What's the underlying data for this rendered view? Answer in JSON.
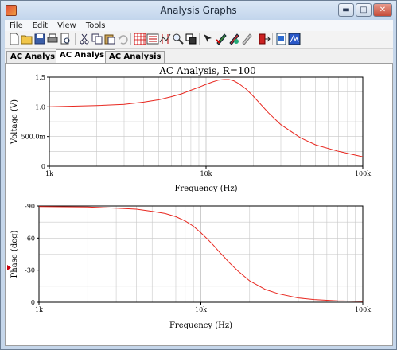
{
  "window": {
    "title": "Analysis Graphs"
  },
  "menu": [
    "File",
    "Edit",
    "View",
    "Tools"
  ],
  "toolbar": {
    "icons": [
      "new-icon",
      "open-icon",
      "save-icon",
      "print-icon",
      "print-preview-icon",
      "cut-icon",
      "copy-icon",
      "paste-icon",
      "undo-icon",
      "grid-icon",
      "legend-icon",
      "cursors-icon",
      "zoom-icon",
      "overlay-icon",
      "select-trace-icon",
      "pen-color-icon",
      "pen-style-icon",
      "properties-icon",
      "export-icon",
      "page-properties-icon",
      "graph-properties-icon"
    ]
  },
  "tabs": [
    "AC Analysis",
    "AC Analysis",
    "AC Analysis"
  ],
  "active_tab": 1,
  "colors": {
    "trace": "#e8271f",
    "grid": "#c8c8c8",
    "axis": "#000000",
    "marker": "#c8000d"
  },
  "chart_data": [
    {
      "type": "line",
      "title": "AC Analysis, R=100",
      "xlabel": "Frequency (Hz)",
      "ylabel": "Voltage (V)",
      "x_scale": "log",
      "xlim": [
        1000,
        100000
      ],
      "ylim": [
        0,
        1.5
      ],
      "x_ticks": [
        "1k",
        "10k",
        "100k"
      ],
      "y_ticks": [
        "0",
        "500.0m",
        "1.0",
        "1.5"
      ],
      "grid": true,
      "series": [
        {
          "x": [
            1000,
            2000,
            3000,
            4000,
            5000,
            6000,
            7000,
            8000,
            9000,
            10000,
            11000,
            12000,
            13000,
            14000,
            15000,
            16000,
            18000,
            20000,
            25000,
            30000,
            40000,
            50000,
            70000,
            100000
          ],
          "y": [
            1.0,
            1.02,
            1.04,
            1.08,
            1.12,
            1.17,
            1.22,
            1.28,
            1.33,
            1.38,
            1.42,
            1.45,
            1.46,
            1.46,
            1.44,
            1.4,
            1.3,
            1.18,
            0.9,
            0.7,
            0.48,
            0.36,
            0.25,
            0.16
          ]
        }
      ]
    },
    {
      "type": "line",
      "title": "",
      "xlabel": "Frequency (Hz)",
      "ylabel": "Phase (deg)",
      "x_scale": "log",
      "xlim": [
        1000,
        100000
      ],
      "ylim": [
        -90,
        0
      ],
      "x_ticks": [
        "1k",
        "10k",
        "100k"
      ],
      "y_ticks": [
        "0",
        "-30",
        "-60",
        "-90"
      ],
      "grid": true,
      "series": [
        {
          "x": [
            1000,
            2000,
            3000,
            4000,
            5000,
            6000,
            7000,
            8000,
            9000,
            10000,
            11000,
            12000,
            13000,
            14000,
            15000,
            17000,
            20000,
            25000,
            30000,
            40000,
            50000,
            70000,
            100000
          ],
          "y": [
            -0.5,
            -1,
            -2,
            -3,
            -5,
            -7,
            -10,
            -14,
            -19,
            -25,
            -31,
            -37,
            -43,
            -48,
            -53,
            -61,
            -70,
            -78,
            -82,
            -86,
            -87.5,
            -88.7,
            -89.2
          ]
        }
      ]
    }
  ]
}
